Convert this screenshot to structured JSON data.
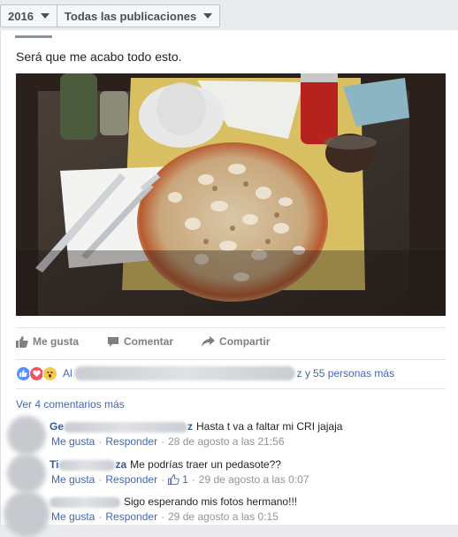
{
  "filter": {
    "year": "2016",
    "scope": "Todas las publicaciones"
  },
  "post": {
    "text": "Será que me acabo todo esto.",
    "actions": {
      "like": "Me gusta",
      "comment": "Comentar",
      "share": "Compartir"
    },
    "reactions": {
      "prefix": "Al",
      "suffix": "z y ",
      "others": "55 personas más"
    }
  },
  "comments": {
    "view_more": "Ver 4 comentarios más",
    "items": [
      {
        "name_visible": "Ge",
        "name_tail": "z",
        "text": "Hasta t va a faltar mi CRI jajaja",
        "like": "Me gusta",
        "reply": "Responder",
        "time": "28 de agosto a las 21:56",
        "likes": ""
      },
      {
        "name_visible": "Ti",
        "name_tail": "za",
        "text": "Me podrías traer un pedasote??",
        "like": "Me gusta",
        "reply": "Responder",
        "time": "29 de agosto a las 0:07",
        "likes": "1"
      },
      {
        "name_visible": "",
        "name_tail": "",
        "text": "Sigo esperando mis fotos hermano!!!",
        "like": "Me gusta",
        "reply": "Responder",
        "time": "29 de agosto a las 0:15",
        "likes": ""
      }
    ]
  },
  "icons": {
    "reaction_like": "like-reaction-icon",
    "reaction_love": "love-reaction-icon",
    "reaction_wow": "wow-reaction-icon"
  },
  "colors": {
    "link": "#4267b2",
    "name": "#365899",
    "meta": "#90949c"
  }
}
